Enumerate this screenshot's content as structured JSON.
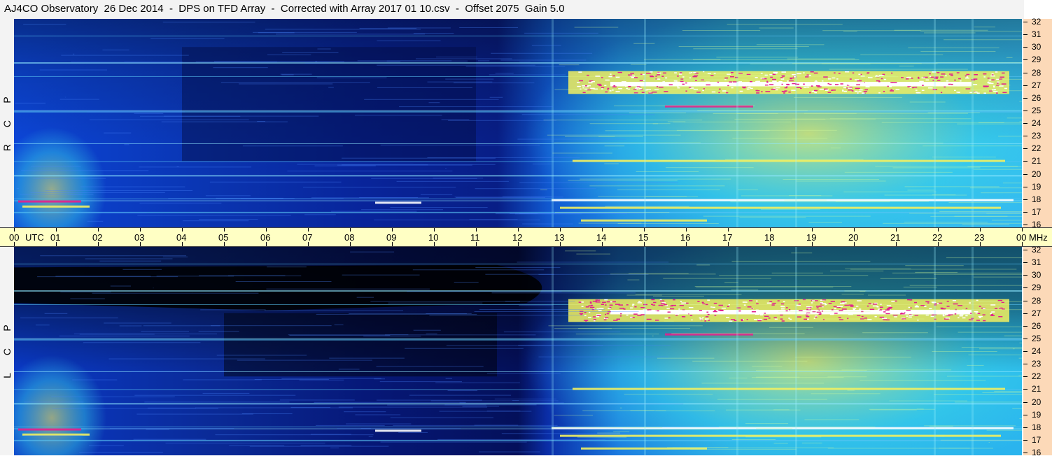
{
  "title": "AJ4CO Observatory  26 Dec 2014  -  DPS on TFD Array  -  Corrected with Array 2017 01 10.csv  -  Offset 2075  Gain 5.0",
  "panels": [
    {
      "id": "rcp",
      "letters": [
        "P",
        "C",
        "R"
      ]
    },
    {
      "id": "lcp",
      "letters": [
        "P",
        "C",
        "L"
      ]
    }
  ],
  "time_axis": {
    "labels": [
      "00",
      "UTC",
      "01",
      "02",
      "03",
      "04",
      "05",
      "06",
      "07",
      "08",
      "09",
      "10",
      "11",
      "12",
      "13",
      "14",
      "15",
      "16",
      "17",
      "18",
      "19",
      "20",
      "21",
      "22",
      "23",
      "00",
      "MHz"
    ]
  },
  "colors": {
    "background_blue": "#0b3fd0",
    "quiet_dark": "#000000",
    "activity_cyan": "#38d6e8",
    "activity_yellow": "#f2f060",
    "activity_magenta": "#e2208c",
    "saturated_white": "#ffffff",
    "axis_bg": "#fcd9b8",
    "time_axis_bg": "#ffffc4"
  },
  "chart_data": {
    "type": "heatmap",
    "title": "AJ4CO Observatory  26 Dec 2014  -  DPS on TFD Array  -  Corrected with Array 2017 01 10.csv  -  Offset 2075  Gain 5.0",
    "x_ticks": [
      "00",
      "01",
      "02",
      "03",
      "04",
      "05",
      "06",
      "07",
      "08",
      "09",
      "10",
      "11",
      "12",
      "13",
      "14",
      "15",
      "16",
      "17",
      "18",
      "19",
      "20",
      "21",
      "22",
      "23",
      "00"
    ],
    "x_unit": "UTC",
    "xlim": [
      0,
      24
    ],
    "y_ticks": [
      16,
      17,
      18,
      19,
      20,
      21,
      22,
      23,
      24,
      25,
      26,
      27,
      28,
      29,
      30,
      31,
      32
    ],
    "y_unit": "MHz",
    "ylim": [
      16,
      32
    ],
    "panels": [
      "RCP",
      "LCP"
    ],
    "features": {
      "strong_band_center_mhz": 27,
      "activity_start_utc": 12.5,
      "quiet_period_utc": [
        4,
        11
      ]
    }
  }
}
